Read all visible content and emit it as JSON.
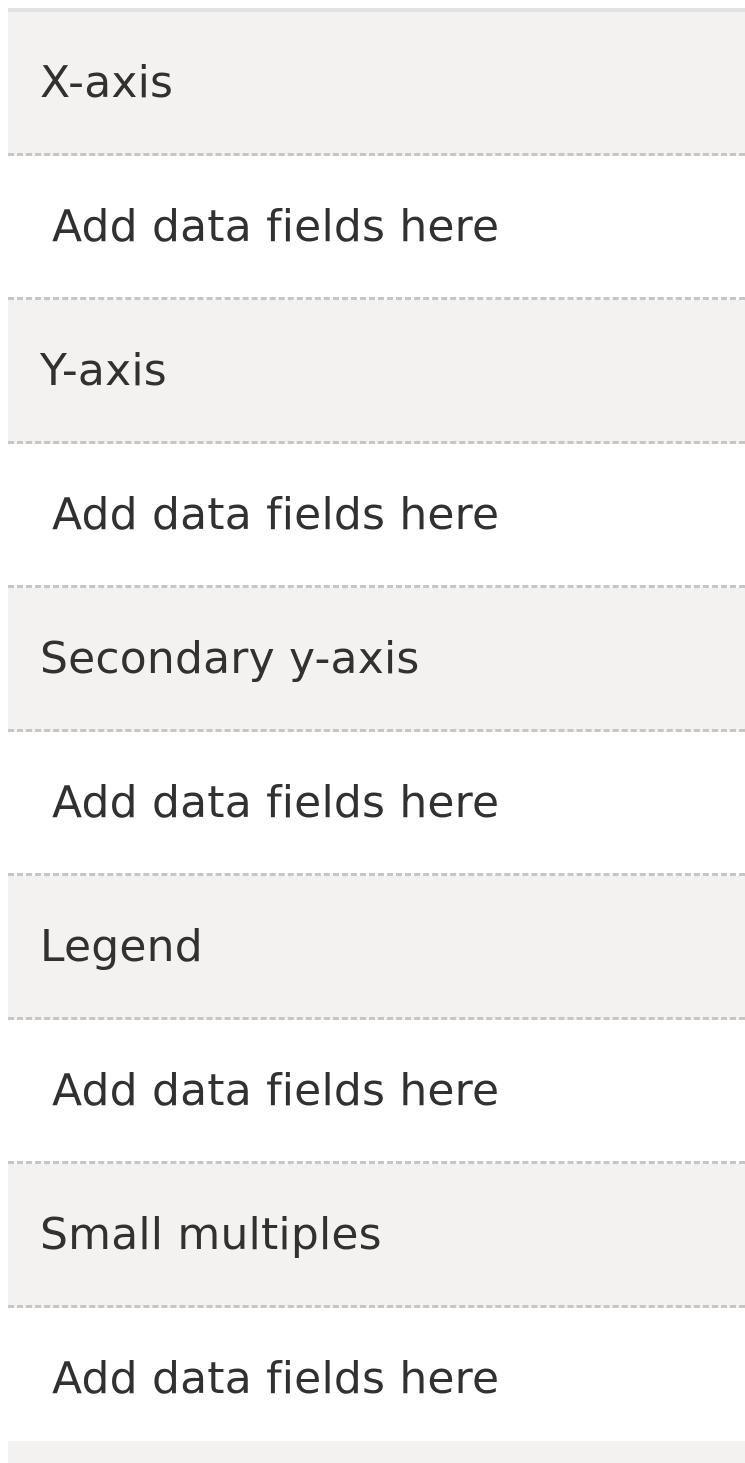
{
  "wells": [
    {
      "header": "X-axis",
      "placeholder": "Add data fields here"
    },
    {
      "header": "Y-axis",
      "placeholder": "Add data fields here"
    },
    {
      "header": "Secondary y-axis",
      "placeholder": "Add data fields here"
    },
    {
      "header": "Legend",
      "placeholder": "Add data fields here"
    },
    {
      "header": "Small multiples",
      "placeholder": "Add data fields here"
    }
  ],
  "colors": {
    "header_bg": "#f3f2f1",
    "drop_bg": "#ffffff",
    "divider": "#c8c6c4",
    "text": "#323130"
  }
}
